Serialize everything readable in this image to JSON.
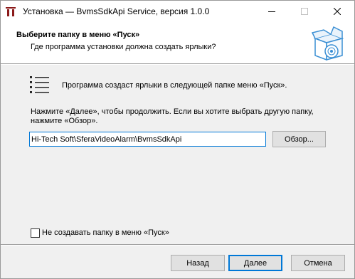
{
  "window": {
    "title": "Установка — BvmsSdkApi Service, версия 1.0.0",
    "icon": "installer-icon",
    "controls": [
      "minimize-icon",
      "maximize-icon",
      "close-icon"
    ]
  },
  "header": {
    "title": "Выберите папку в меню «Пуск»",
    "subtitle": "Где программа установки должна создать ярлыки?",
    "graphic": "setup-box-icon"
  },
  "body": {
    "info_icon": "list-icon",
    "info_text": "Программа создаст ярлыки в следующей папке меню «Пуск».",
    "instructions": "Нажмите «Далее», чтобы продолжить. Если вы хотите выбрать другую папку, нажмите «Обзор».",
    "folder_value": "Hi-Tech Soft\\SferaVideoAlarm\\BvmsSdkApi",
    "browse_label": "Обзор...",
    "no_create_label": "Не создавать папку в меню «Пуск»",
    "no_create_checked": false
  },
  "footer": {
    "back_label": "Назад",
    "next_label": "Далее",
    "cancel_label": "Отмена"
  },
  "colors": {
    "accent": "#0078d7",
    "icon_red": "#8b1a1a",
    "box_blue": "#3a8fd4"
  }
}
